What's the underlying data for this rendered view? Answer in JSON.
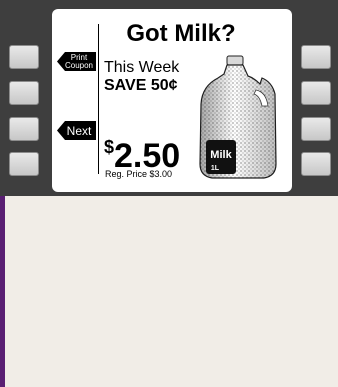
{
  "screen": {
    "title": "Got Milk?",
    "promo_line1": "This Week",
    "promo_line2": "SAVE 50¢",
    "price_symbol": "$",
    "price_value": "2.50",
    "reg_price": "Reg. Price $3.00"
  },
  "softkeys": {
    "print_coupon_line1": "Print",
    "print_coupon_line2": "Coupon",
    "next": "Next"
  },
  "jug": {
    "label": "Milk",
    "label_sub": "1L"
  },
  "colors": {
    "bezel": "#3e3e3e",
    "accent_top": "#f0b24a",
    "accent_bottom": "#5a1f73",
    "background": "#f1ede7"
  }
}
